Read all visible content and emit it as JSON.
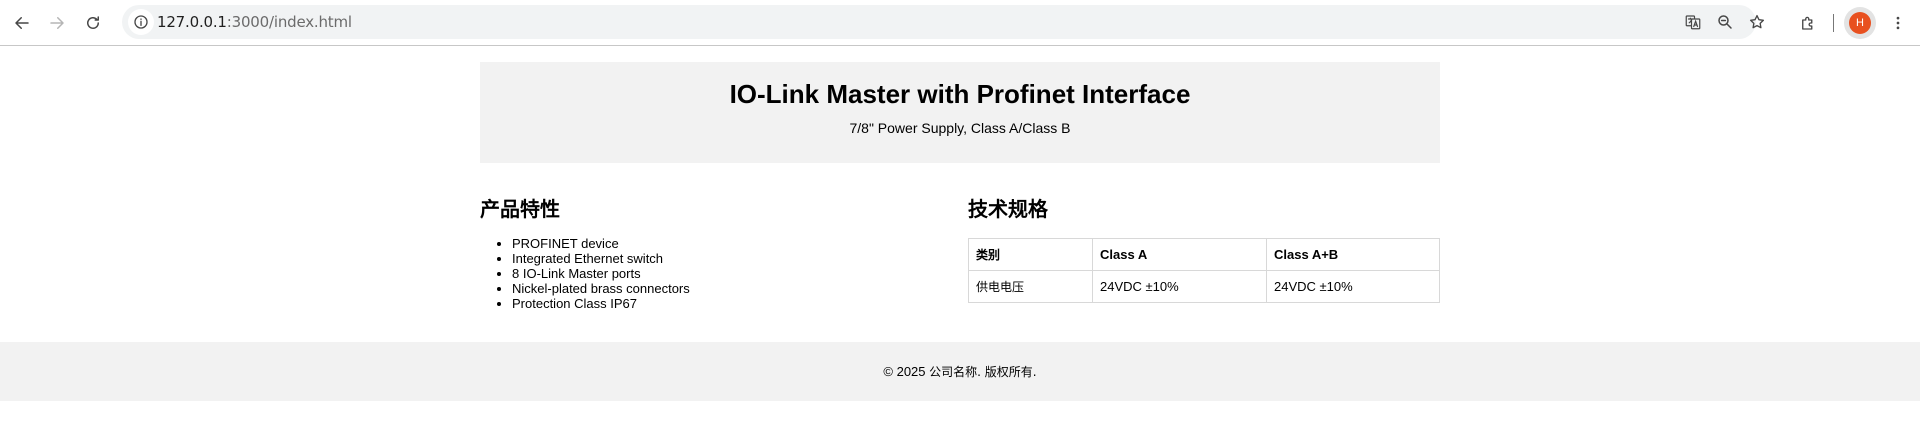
{
  "browser": {
    "url_host": "127.0.0.1",
    "url_path": ":3000/index.html",
    "avatar_letter": "H",
    "avatar_color": "#e8501f"
  },
  "hero": {
    "title": "IO-Link Master with Profinet Interface",
    "subtitle": "7/8\" Power Supply, Class A/Class B"
  },
  "features": {
    "heading": "产品特性",
    "items": [
      "PROFINET device",
      "Integrated Ethernet switch",
      "8 IO-Link Master ports",
      "Nickel-plated brass connectors",
      "Protection Class IP67"
    ]
  },
  "specs": {
    "heading": "技术规格",
    "columns": [
      "类别",
      "Class A",
      "Class A+B"
    ],
    "rows": [
      [
        "供电电压",
        "24VDC ±10%",
        "24VDC ±10%"
      ]
    ]
  },
  "footer": {
    "copyright": "© 2025 ",
    "company": "公司名称. 版权所有."
  },
  "icons": {
    "back": "arrow-left-icon",
    "forward": "arrow-right-icon",
    "reload": "reload-icon",
    "site_info": "info-icon",
    "translate": "translate-icon",
    "zoom": "zoom-out-icon",
    "bookmark": "star-icon",
    "extensions": "puzzle-icon",
    "menu": "more-vertical-icon"
  }
}
